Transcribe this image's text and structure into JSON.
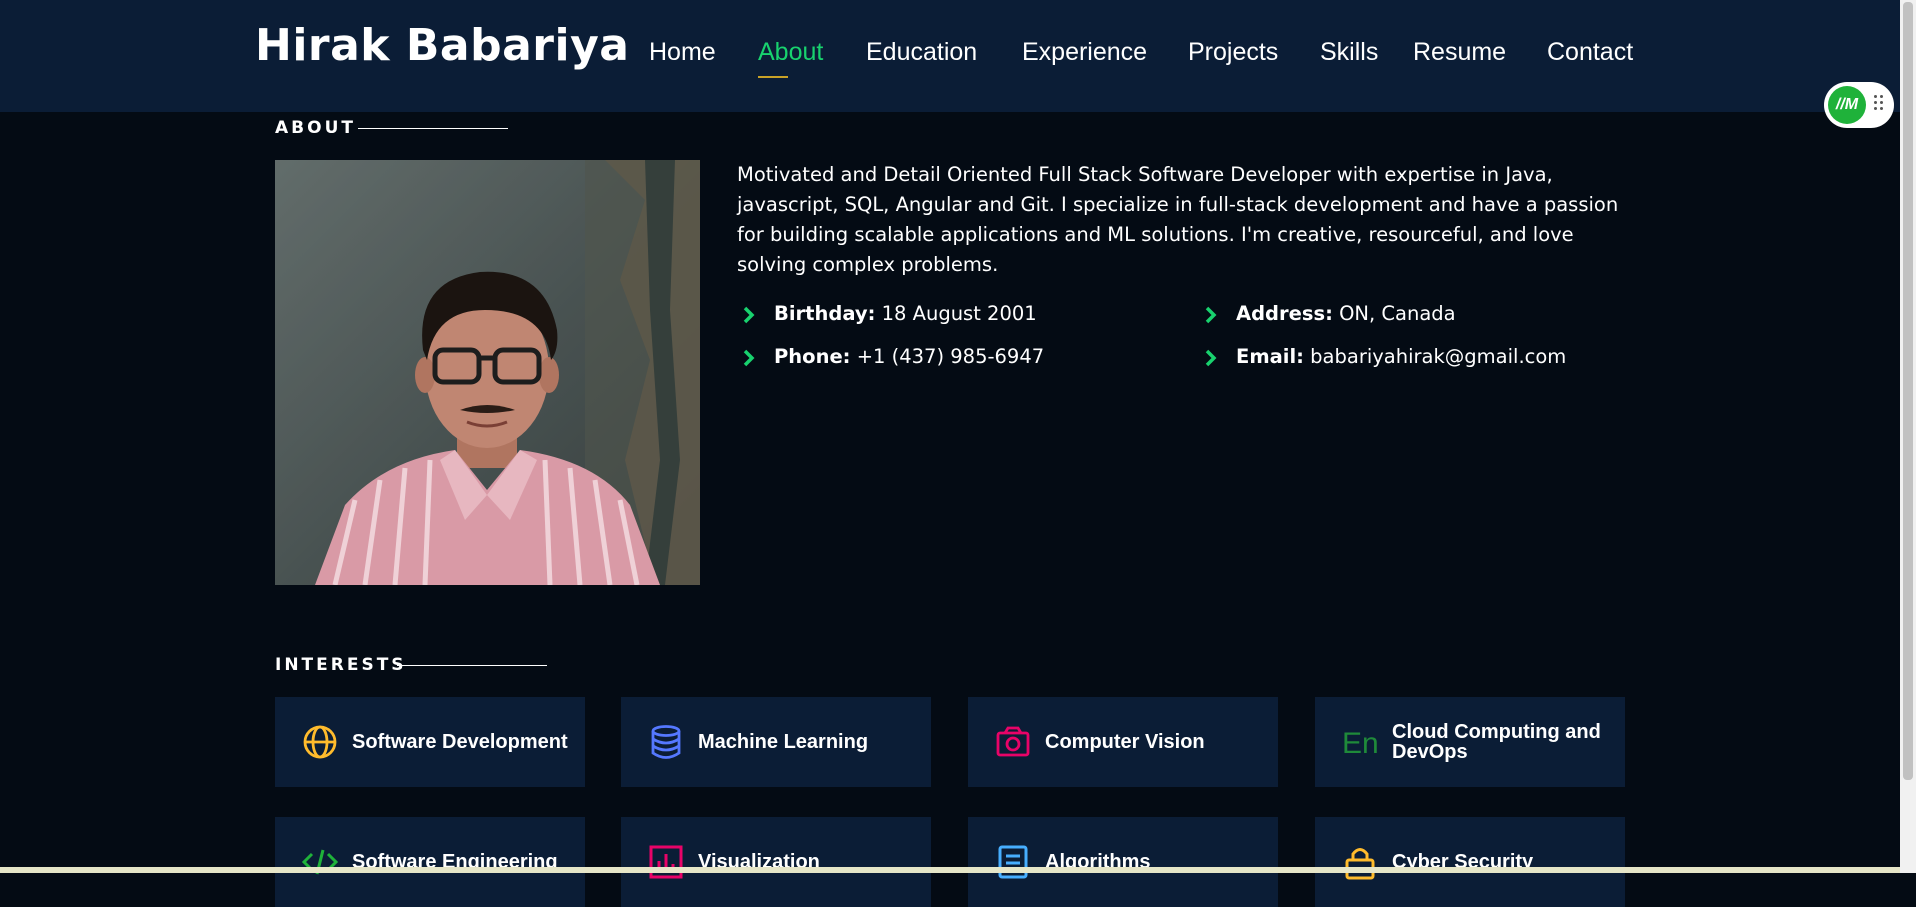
{
  "header": {
    "brand": "Hirak Babariya",
    "nav": [
      "Home",
      "About",
      "Education",
      "Experience",
      "Projects",
      "Skills",
      "Resume",
      "Contact"
    ],
    "active_nav": "About"
  },
  "about": {
    "section_title": "ABOUT",
    "photo_alt": "Portrait photo",
    "bio": "Motivated and Detail Oriented Full Stack Software Developer with expertise in Java, javascript, SQL, Angular and Git. I specialize in full-stack development and have a passion for building scalable applications and ML solutions. I'm creative, resourceful, and love solving complex problems.",
    "info": [
      {
        "label": "Birthday:",
        "value": "18 August 2001"
      },
      {
        "label": "Address:",
        "value": "ON, Canada"
      },
      {
        "label": "Phone:",
        "value": "+1 (437) 985-6947"
      },
      {
        "label": "Email:",
        "value": "babariyahirak@gmail.com"
      }
    ]
  },
  "interests": {
    "section_title": "INTERESTS",
    "items": [
      {
        "label": "Software Development",
        "icon": "globe-icon",
        "color": "#ffbb2c"
      },
      {
        "label": "Machine Learning",
        "icon": "database-icon",
        "color": "#5578ff"
      },
      {
        "label": "Computer Vision",
        "icon": "camera-icon",
        "color": "#e80368"
      },
      {
        "label": "Cloud Computing and DevOps",
        "icon": "En",
        "color": "#11dbcf"
      },
      {
        "label": "Software Engineering",
        "icon": "code-icon",
        "color": "#1fb23a"
      },
      {
        "label": "Visualization",
        "icon": "bar-chart-icon",
        "color": "#e80368"
      },
      {
        "label": "Algorithms",
        "icon": "document-icon",
        "color": "#47aeff"
      },
      {
        "label": "Cyber Security",
        "icon": "lock-icon",
        "color": "#ffbb2c"
      }
    ]
  },
  "widget": {
    "badge": "//M"
  },
  "colors": {
    "accent": "#18d26e",
    "header_bg": "#0b1d36",
    "page_bg": "#040b14",
    "card_bg": "#0b1d36"
  }
}
